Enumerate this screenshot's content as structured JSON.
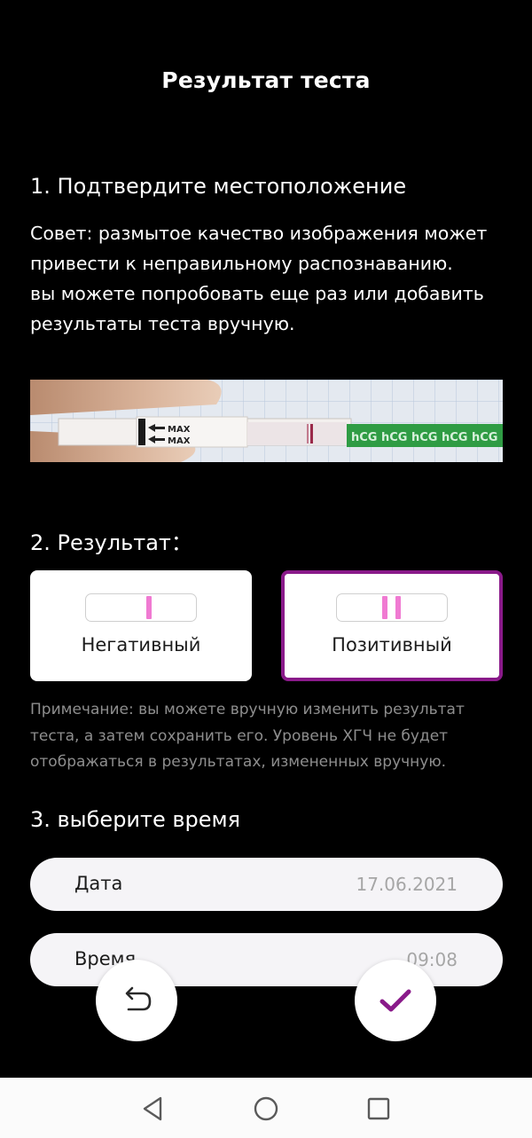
{
  "header": {
    "title": "Результат теста"
  },
  "section1": {
    "title": "1. Подтвердите местоположение",
    "tip_lines": [
      "Совет: размытое качество изображения может",
      "привести к неправильному распознаванию.",
      "вы можете попробовать еще раз или добавить",
      "результаты теста вручную."
    ],
    "photo": {
      "max_label": "MAX",
      "brand_text": "hCG hCG hCG hCG hCG"
    }
  },
  "section2": {
    "title": "2. Результат：",
    "options": [
      {
        "label": "Негативный",
        "selected": false
      },
      {
        "label": "Позитивный",
        "selected": true
      }
    ],
    "note_lines": [
      "Примечание: вы можете вручную изменить результат",
      "теста, а затем сохранить его. Уровень ХГЧ не будет",
      "отображаться в результатах, измененных вручную."
    ]
  },
  "section3": {
    "title": "3. выберите время",
    "date": {
      "label": "Дата",
      "value": "17.06.2021"
    },
    "time": {
      "label": "Время",
      "value": "09:08"
    }
  },
  "colors": {
    "accent": "#8a1a8a",
    "strip_line": "#f07ad2",
    "background": "#000000",
    "note_text": "#8e8e8e"
  },
  "icons": {
    "undo": "undo-arrow-icon",
    "confirm": "checkmark-icon",
    "nav_back": "triangle-back-icon",
    "nav_home": "circle-home-icon",
    "nav_recent": "square-recent-icon"
  }
}
